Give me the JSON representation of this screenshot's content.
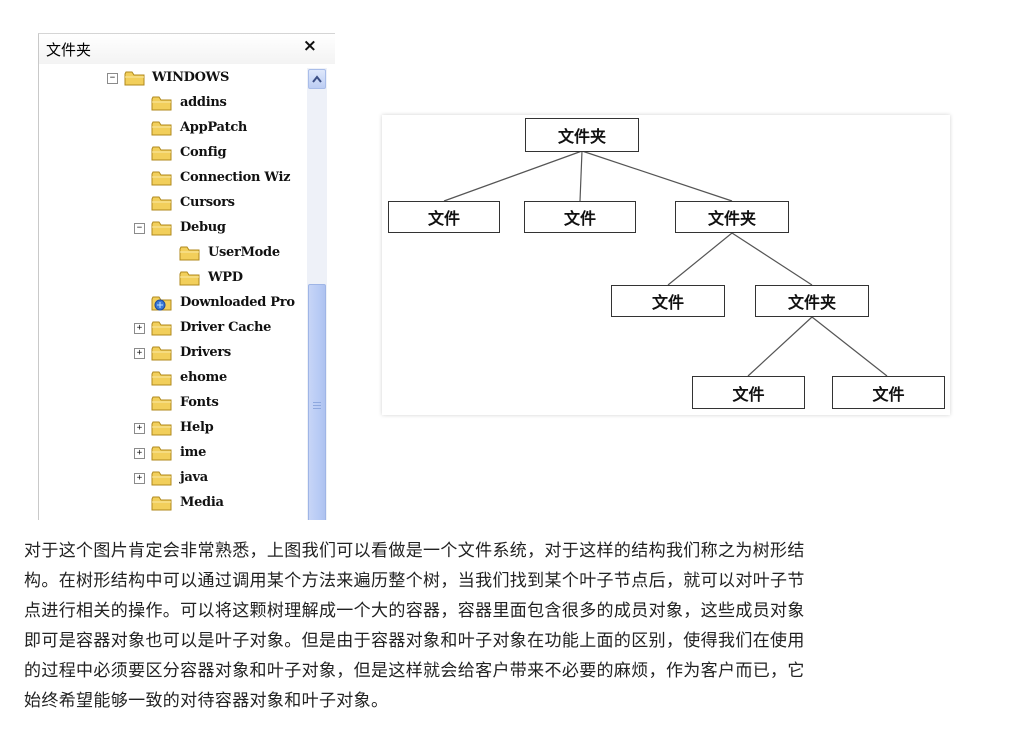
{
  "folder_pane": {
    "title": "文件夹",
    "close_label": "×",
    "items": [
      {
        "label": "WINDOWS",
        "expander": "−",
        "icon": "folder-icon"
      },
      {
        "label": "addins",
        "expander": "",
        "icon": "folder-icon"
      },
      {
        "label": "AppPatch",
        "expander": "",
        "icon": "folder-icon"
      },
      {
        "label": "Config",
        "expander": "",
        "icon": "folder-icon"
      },
      {
        "label": "Connection Wiz",
        "expander": "",
        "icon": "folder-icon"
      },
      {
        "label": "Cursors",
        "expander": "",
        "icon": "folder-icon"
      },
      {
        "label": "Debug",
        "expander": "−",
        "icon": "folder-icon"
      },
      {
        "label": "UserMode",
        "expander": "",
        "icon": "folder-icon"
      },
      {
        "label": "WPD",
        "expander": "",
        "icon": "folder-icon"
      },
      {
        "label": "Downloaded Pro",
        "expander": "",
        "icon": "special-folder-icon"
      },
      {
        "label": "Driver Cache",
        "expander": "+",
        "icon": "folder-icon"
      },
      {
        "label": "Drivers",
        "expander": "+",
        "icon": "folder-icon"
      },
      {
        "label": "ehome",
        "expander": "",
        "icon": "folder-icon"
      },
      {
        "label": "Fonts",
        "expander": "",
        "icon": "folder-icon"
      },
      {
        "label": "Help",
        "expander": "+",
        "icon": "folder-icon"
      },
      {
        "label": "ime",
        "expander": "+",
        "icon": "folder-icon"
      },
      {
        "label": "java",
        "expander": "+",
        "icon": "folder-icon"
      },
      {
        "label": "Media",
        "expander": "",
        "icon": "folder-icon"
      }
    ]
  },
  "diagram": {
    "nodes": [
      {
        "id": "root",
        "label": "文件夹"
      },
      {
        "id": "l1-file-a",
        "label": "文件"
      },
      {
        "id": "l1-file-b",
        "label": "文件"
      },
      {
        "id": "l1-folder",
        "label": "文件夹"
      },
      {
        "id": "l2-file",
        "label": "文件"
      },
      {
        "id": "l2-folder",
        "label": "文件夹"
      },
      {
        "id": "l3-file-a",
        "label": "文件"
      },
      {
        "id": "l3-file-b",
        "label": "文件"
      }
    ]
  },
  "paragraph": {
    "lines": [
      "对于这个图片肯定会非常熟悉，上图我们可以看做是一个文件系统，对于这样的结构我们称之为树形结",
      "构。在树形结构中可以通过调用某个方法来遍历整个树，当我们找到某个叶子节点后，就可以对叶子节",
      "点进行相关的操作。可以将这颗树理解成一个大的容器，容器里面包含很多的成员对象，这些成员对象",
      "即可是容器对象也可以是叶子对象。但是由于容器对象和叶子对象在功能上面的区别，使得我们在使用",
      "的过程中必须要区分容器对象和叶子对象，但是这样就会给客户带来不必要的麻烦，作为客户而已，它",
      "始终希望能够一致的对待容器对象和叶子对象。"
    ]
  },
  "colors": {
    "folder_fill": "#f2cf5b",
    "folder_stroke": "#b08a1e",
    "scrollbar_accent": "#b8cbf5",
    "text": "#222222"
  }
}
